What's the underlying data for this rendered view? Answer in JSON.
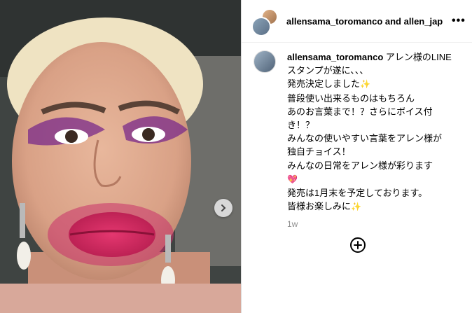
{
  "header": {
    "names": "allensama_toromanco and allen_jap",
    "more_icon": "more-horizontal-icon"
  },
  "caption": {
    "username": "allensama_toromanco",
    "lines": [
      "アレン様のLINE",
      "スタンプが遂に、、、",
      "発売決定しました",
      "普段使い出来るものはもちろん",
      "あのお言葉まで！？さらにボイス付",
      "き！？",
      "みんなの使いやすい言葉をアレン様が",
      "独自チョイス！",
      "みんなの日常をアレン様が彩ります",
      "",
      "発売は1月末を予定しております。",
      "皆様お楽しみに"
    ],
    "sparkle": "✨",
    "heart": "💖",
    "timestamp": "1w"
  },
  "icons": {
    "next": "chevron-right-icon",
    "add": "add-circle-icon"
  },
  "colors": {
    "lips": "#d22a5e",
    "makeup": "#7a2a8a",
    "divider": "#dbdbdb",
    "muted": "#8e8e8e"
  }
}
